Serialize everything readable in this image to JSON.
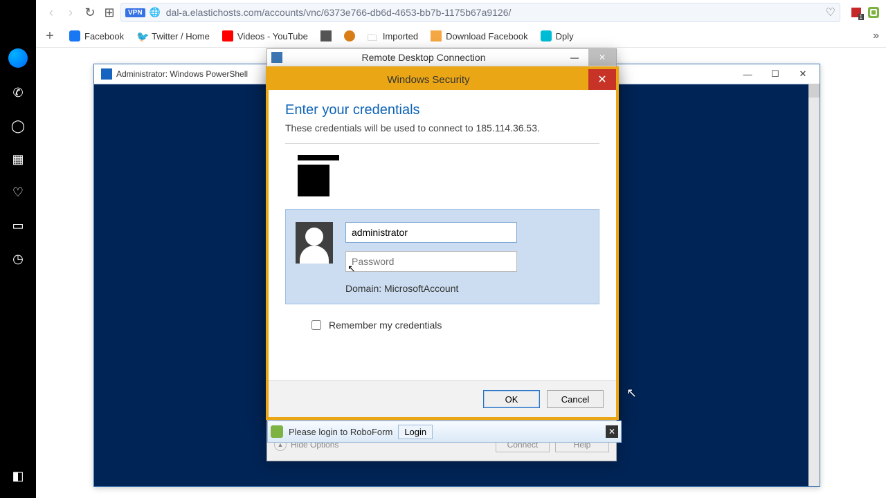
{
  "browser": {
    "url": "dal-a.elastichosts.com/accounts/vnc/6373e766-db6d-4653-bb7b-1175b67a9126/",
    "vpn_badge": "VPN"
  },
  "bookmarks": [
    {
      "label": "Facebook"
    },
    {
      "label": "Twitter / Home"
    },
    {
      "label": "Videos - YouTube"
    },
    {
      "label": ""
    },
    {
      "label": ""
    },
    {
      "label": "Imported"
    },
    {
      "label": "Download Facebook"
    },
    {
      "label": "Dply"
    }
  ],
  "powershell": {
    "title": "Administrator: Windows PowerShell"
  },
  "rdc": {
    "title": "Remote Desktop Connection",
    "hide_options": "Hide Options",
    "connect": "Connect",
    "help": "Help"
  },
  "roboform": {
    "message": "Please login to RoboForm",
    "login": "Login"
  },
  "security": {
    "title": "Windows Security",
    "heading": "Enter your credentials",
    "subtext": "These credentials will be used to connect to 185.114.36.53.",
    "username_value": "administrator",
    "password_placeholder": "Password",
    "domain_line": "Domain: MicrosoftAccount",
    "remember": "Remember my credentials",
    "ok": "OK",
    "cancel": "Cancel"
  }
}
